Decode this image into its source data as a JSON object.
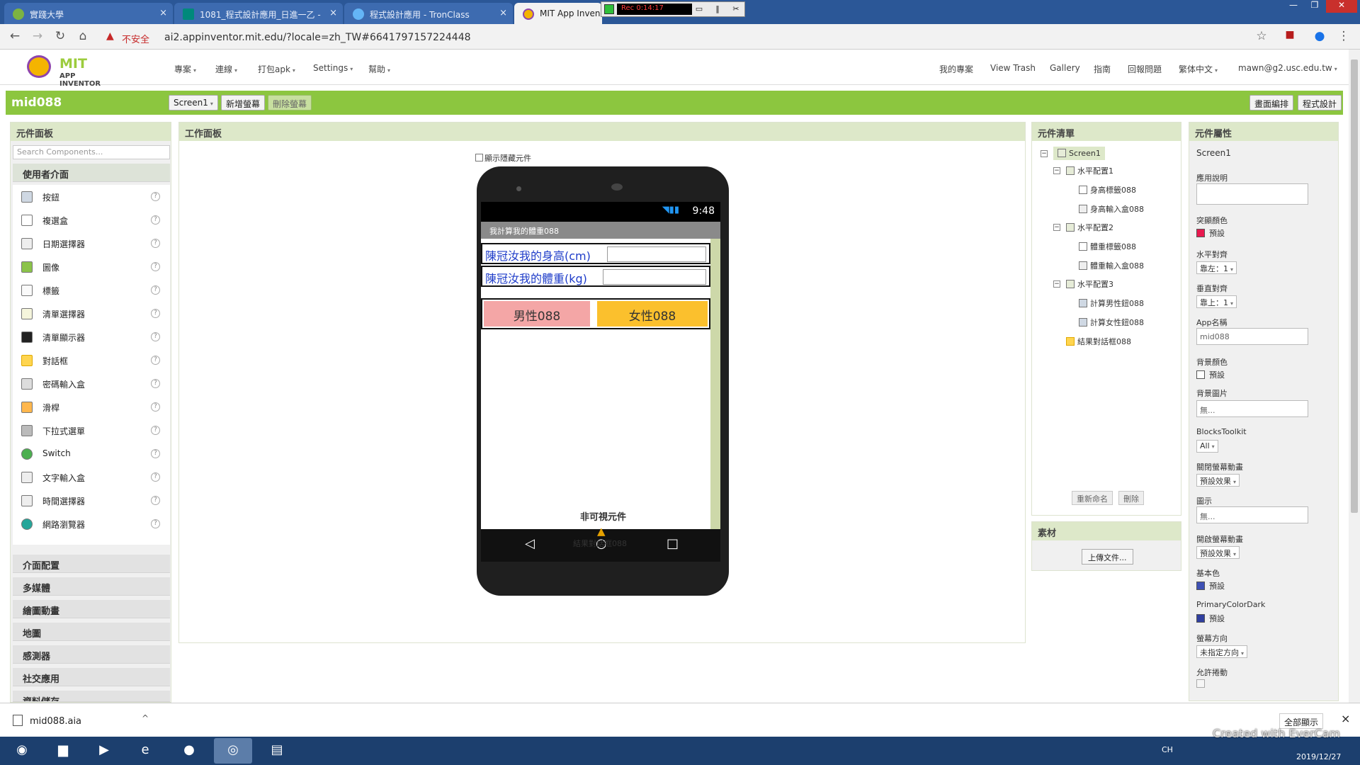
{
  "browser": {
    "tabs": [
      {
        "title": "實踐大學",
        "close": "×"
      },
      {
        "title": "1081_程式設計應用_日進一乙 - ",
        "close": "×"
      },
      {
        "title": "程式設計應用 - TronClass",
        "close": "×"
      },
      {
        "title": "MIT App Inven",
        "close": ""
      }
    ],
    "recorder": {
      "time": "Rec 0:14:17"
    },
    "insecure_label": "不安全",
    "url": "ai2.appinventor.mit.edu/?locale=zh_TW#6641797157224448"
  },
  "appinventor": {
    "logo": {
      "mit": "MIT",
      "sub": "APP INVENTOR"
    },
    "menus": [
      "專案",
      "連線",
      "打包apk",
      "Settings",
      "幫助"
    ],
    "right_links": [
      "我的專案",
      "View Trash",
      "Gallery",
      "指南",
      "回報問題",
      "繁体中文",
      "mawn@g2.usc.edu.tw"
    ],
    "project_name": "mid088",
    "screen_select": "Screen1",
    "add_screen": "新增螢幕",
    "remove_screen": "刪除螢幕",
    "designer": "畫面編排",
    "blocks": "程式設計"
  },
  "palette": {
    "title": "元件面板",
    "search_placeholder": "Search Components...",
    "active_category": "使用者介面",
    "components": [
      "按鈕",
      "複選盒",
      "日期選擇器",
      "圖像",
      "標籤",
      "清單選擇器",
      "清單顯示器",
      "對話框",
      "密碼輸入盒",
      "滑桿",
      "下拉式選單",
      "Switch",
      "文字輸入盒",
      "時間選擇器",
      "網路瀏覽器"
    ],
    "help": "?",
    "categories": [
      "介面配置",
      "多媒體",
      "繪圖動畫",
      "地圖",
      "感測器",
      "社交應用",
      "資料儲存"
    ]
  },
  "viewer": {
    "title": "工作面板",
    "show_hidden": "顯示隱藏元件",
    "status_time": "9:48",
    "app_title": "我計算我的體重088",
    "height_label": "陳冠汝我的身高(cm)",
    "weight_label": "陳冠汝我的體重(kg)",
    "male_button": "男性088",
    "female_button": "女性088",
    "non_visible_title": "非可視元件",
    "non_visible_item": "結果對話框088",
    "nav": {
      "back": "◁",
      "home": "○",
      "recent": "□"
    }
  },
  "tree": {
    "title": "元件清單",
    "nodes": [
      "Screen1",
      "水平配置1",
      "身高標籤088",
      "身高輸入盒088",
      "水平配置2",
      "體重標籤088",
      "體重輸入盒088",
      "水平配置3",
      "計算男性鈕088",
      "計算女性鈕088",
      "結果對話框088"
    ],
    "rename": "重新命名",
    "delete": "刪除"
  },
  "media": {
    "title": "素材",
    "upload": "上傳文件..."
  },
  "properties": {
    "title": "元件屬性",
    "component": "Screen1",
    "about": "應用說明",
    "accent_color": "突顯顏色",
    "accent_value": "預設",
    "accent_hex": "#e8194f",
    "align_h": "水平對齊",
    "align_h_value": "靠左：1",
    "align_v": "垂直對齊",
    "align_v_value": "靠上：1",
    "app_name": "App名稱",
    "app_name_value": "mid088",
    "bg_color": "背景顏色",
    "bg_color_value": "預設",
    "bg_hex": "#ffffff",
    "bg_image": "背景圖片",
    "bg_image_value": "無...",
    "blocks_toolkit": "BlocksToolkit",
    "blocks_toolkit_value": "All",
    "open_anim": "關閉螢幕動畫",
    "open_anim_value": "預設效果",
    "icon": "圖示",
    "icon_value": "無...",
    "close_anim": "開啟螢幕動畫",
    "close_anim_value": "預設效果",
    "primary": "基本色",
    "primary_value": "預設",
    "primary_hex": "#3f51b5",
    "primary_dark": "PrimaryColorDark",
    "primary_dark_value": "預設",
    "primary_dark_hex": "#303f9f",
    "orientation": "螢幕方向",
    "orientation_value": "未指定方向",
    "scrollable": "允許捲動"
  },
  "download": {
    "file": "mid088.aia",
    "show_all": "全部顯示",
    "close": "×"
  },
  "taskbar": {
    "lang": "CH",
    "watermark": "Created with EverCam",
    "date": "2019/12/27"
  }
}
